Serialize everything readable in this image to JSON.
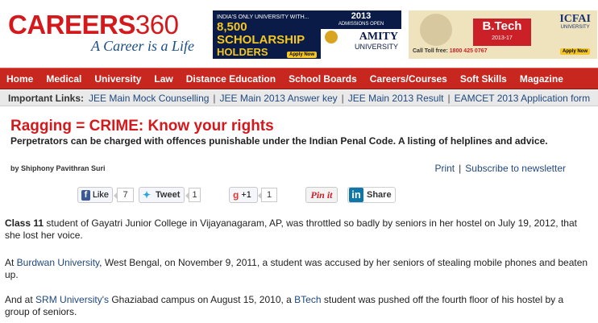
{
  "brand": {
    "logo_main": "CAREERS",
    "logo_num": "360",
    "tagline": "A Career is a Life"
  },
  "ads": {
    "amity": {
      "headline_small": "INDIA'S ONLY UNIVERSITY WITH...",
      "headline_big1": "8,500 SCHOLARSHIP",
      "headline_big2": "HOLDERS",
      "year": "2013",
      "admissions": "ADMISSIONS OPEN",
      "name": "AMITY",
      "university": "UNIVERSITY",
      "apply": "Apply Now"
    },
    "icfai": {
      "btech": "B.Tech",
      "years": "2013-17",
      "name": "ICFAI",
      "university": "UNIVERSITY",
      "toll_label": "Call Toll free:",
      "toll_number": "1800 425 0767",
      "apply": "Apply Now"
    }
  },
  "nav": {
    "items": [
      "Home",
      "Medical",
      "University",
      "Law",
      "Distance Education",
      "School Boards",
      "Careers/Courses",
      "Soft Skills",
      "Magazine"
    ]
  },
  "important_links": {
    "label": "Important Links:",
    "items": [
      "JEE Main Mock Counselling",
      "JEE Main 2013 Answer key",
      "JEE Main 2013 Result",
      "EAMCET 2013 Application form"
    ],
    "separator": "|"
  },
  "article": {
    "title": "Ragging = CRIME: Know your rights",
    "subtitle": "Perpetrators can be charged with offences punishable under the Indian Penal Code. A listing of helplines and advice.",
    "byline": "by Shiphony Pavithran Suri",
    "print": "Print",
    "pipe": "|",
    "subscribe": "Subscribe to newsletter",
    "paragraphs": {
      "p1_bold": "Class 11",
      "p1_rest": " student of Gayatri Junior College in Vijayanagaram, AP, was throttled so badly by seniors in her hostel on July 19, 2012, that she lost her voice.",
      "p2_pre": "At ",
      "p2_link": "Burdwan University",
      "p2_rest": ", West Bengal, on November 9, 2011, a student was accused by her seniors of stealing mobile phones and beaten up.",
      "p3_pre": "And at ",
      "p3_link1": "SRM University's",
      "p3_mid": " Ghaziabad campus on August 15, 2010, a ",
      "p3_link2": "BTech",
      "p3_rest": " student was pushed off the fourth floor of his hostel by a group of seniors."
    }
  },
  "share": {
    "fb_icon": "f",
    "like": "Like",
    "like_count": "7",
    "tweet": "Tweet",
    "tweet_count": "1",
    "gplus": "+1",
    "gplus_count": "1",
    "pinit": "Pin it",
    "in_icon": "in",
    "linkedin": "Share"
  },
  "colors": {
    "brand_red": "#d4191d",
    "nav_red": "#c7271f",
    "link_blue": "#21497e",
    "tagline_blue": "#1a4f8b"
  }
}
